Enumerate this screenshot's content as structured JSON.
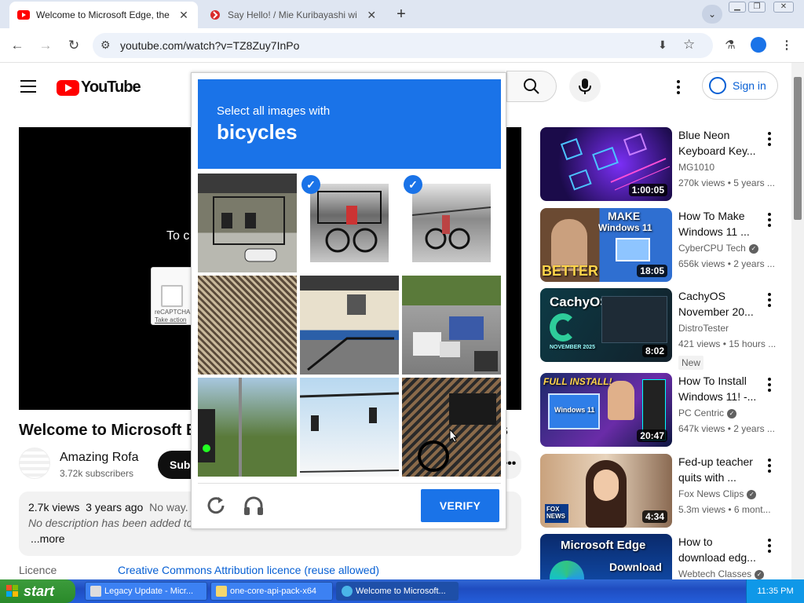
{
  "browser": {
    "tabs": [
      {
        "title": "Welcome to Microsoft Edge, the be",
        "active": true,
        "icon": "youtube-icon"
      },
      {
        "title": "Say Hello! / Mie Kuribayashi with S",
        "active": false,
        "icon": "red-site-icon"
      }
    ],
    "new_tab": "+",
    "url": "youtube.com/watch?v=TZ8Zuy7InPo",
    "tab_search": "⌄"
  },
  "youtube": {
    "logo_text": "YouTube",
    "sign_in": "Sign in",
    "player_partial_text": "To c",
    "mini_captcha": {
      "brand": "reCAPTCHA",
      "link": "Take action"
    },
    "video_title": "Welcome to Microsoft Ed",
    "video_title_tail": "s",
    "channel_name": "Amazing Rofa",
    "channel_subs": "3.72k subscribers",
    "subscribe": "Subs",
    "more_actions": "•••",
    "description": {
      "views": "2.7k views",
      "age": "3 years ago",
      "note": "No way.",
      "no_desc": "No description has been added to",
      "more": "...more"
    },
    "licence_label": "Licence",
    "licence_value": "Creative Commons Attribution licence (reuse allowed)"
  },
  "sidebar": [
    {
      "title": "Blue Neon Keyboard Key...",
      "channel": "MG1010",
      "verified": false,
      "meta": "270k views • 5 years ...",
      "duration": "1:00:05",
      "badge": ""
    },
    {
      "title": "How To Make Windows 11 ...",
      "channel": "CyberCPU Tech",
      "verified": true,
      "meta": "656k views • 2 years ...",
      "duration": "18:05",
      "badge": ""
    },
    {
      "title": "CachyOS November 20...",
      "channel": "DistroTester",
      "verified": false,
      "meta": "421 views • 15 hours ...",
      "duration": "8:02",
      "badge": "New"
    },
    {
      "title": "How To Install Windows 11! -...",
      "channel": "PC Centric",
      "verified": true,
      "meta": "647k views • 2 years ...",
      "duration": "20:47",
      "badge": ""
    },
    {
      "title": "Fed-up teacher quits with ...",
      "channel": "Fox News Clips",
      "verified": true,
      "meta": "5.3m views • 6 mont...",
      "duration": "4:34",
      "badge": ""
    },
    {
      "title": "How to download edg...",
      "channel": "Webtech Classes",
      "verified": true,
      "meta": "",
      "duration": "",
      "badge": ""
    }
  ],
  "thumb_text": {
    "t2_top": "MAKE",
    "t2_mid": "Windows 11",
    "t2_bottom": "BETTER",
    "t3": "CachyOS",
    "t3_sub": "NOVEMBER 2025",
    "t4_top": "FULL INSTALL!",
    "t4_mid": "Windows 11",
    "t5": "FOX NEWS",
    "t6_top": "Microsoft Edge",
    "t6_bottom": "Download"
  },
  "captcha": {
    "instruction": "Select all images with",
    "target": "bicycles",
    "selected_tiles": [
      1,
      2
    ],
    "verify": "VERIFY",
    "reload_icon": "reload-icon",
    "audio_icon": "headphones-icon"
  },
  "taskbar": {
    "start": "start",
    "tasks": [
      {
        "label": "Legacy Update - Micr...",
        "active": false
      },
      {
        "label": "one-core-api-pack-x64",
        "active": false
      },
      {
        "label": "Welcome to Microsoft...",
        "active": true
      }
    ],
    "clock": "11:35 PM"
  },
  "colors": {
    "captcha_blue": "#1a73e8",
    "youtube_red": "#ff0000",
    "link_blue": "#065fd4",
    "xp_taskbar": "#245edb"
  }
}
